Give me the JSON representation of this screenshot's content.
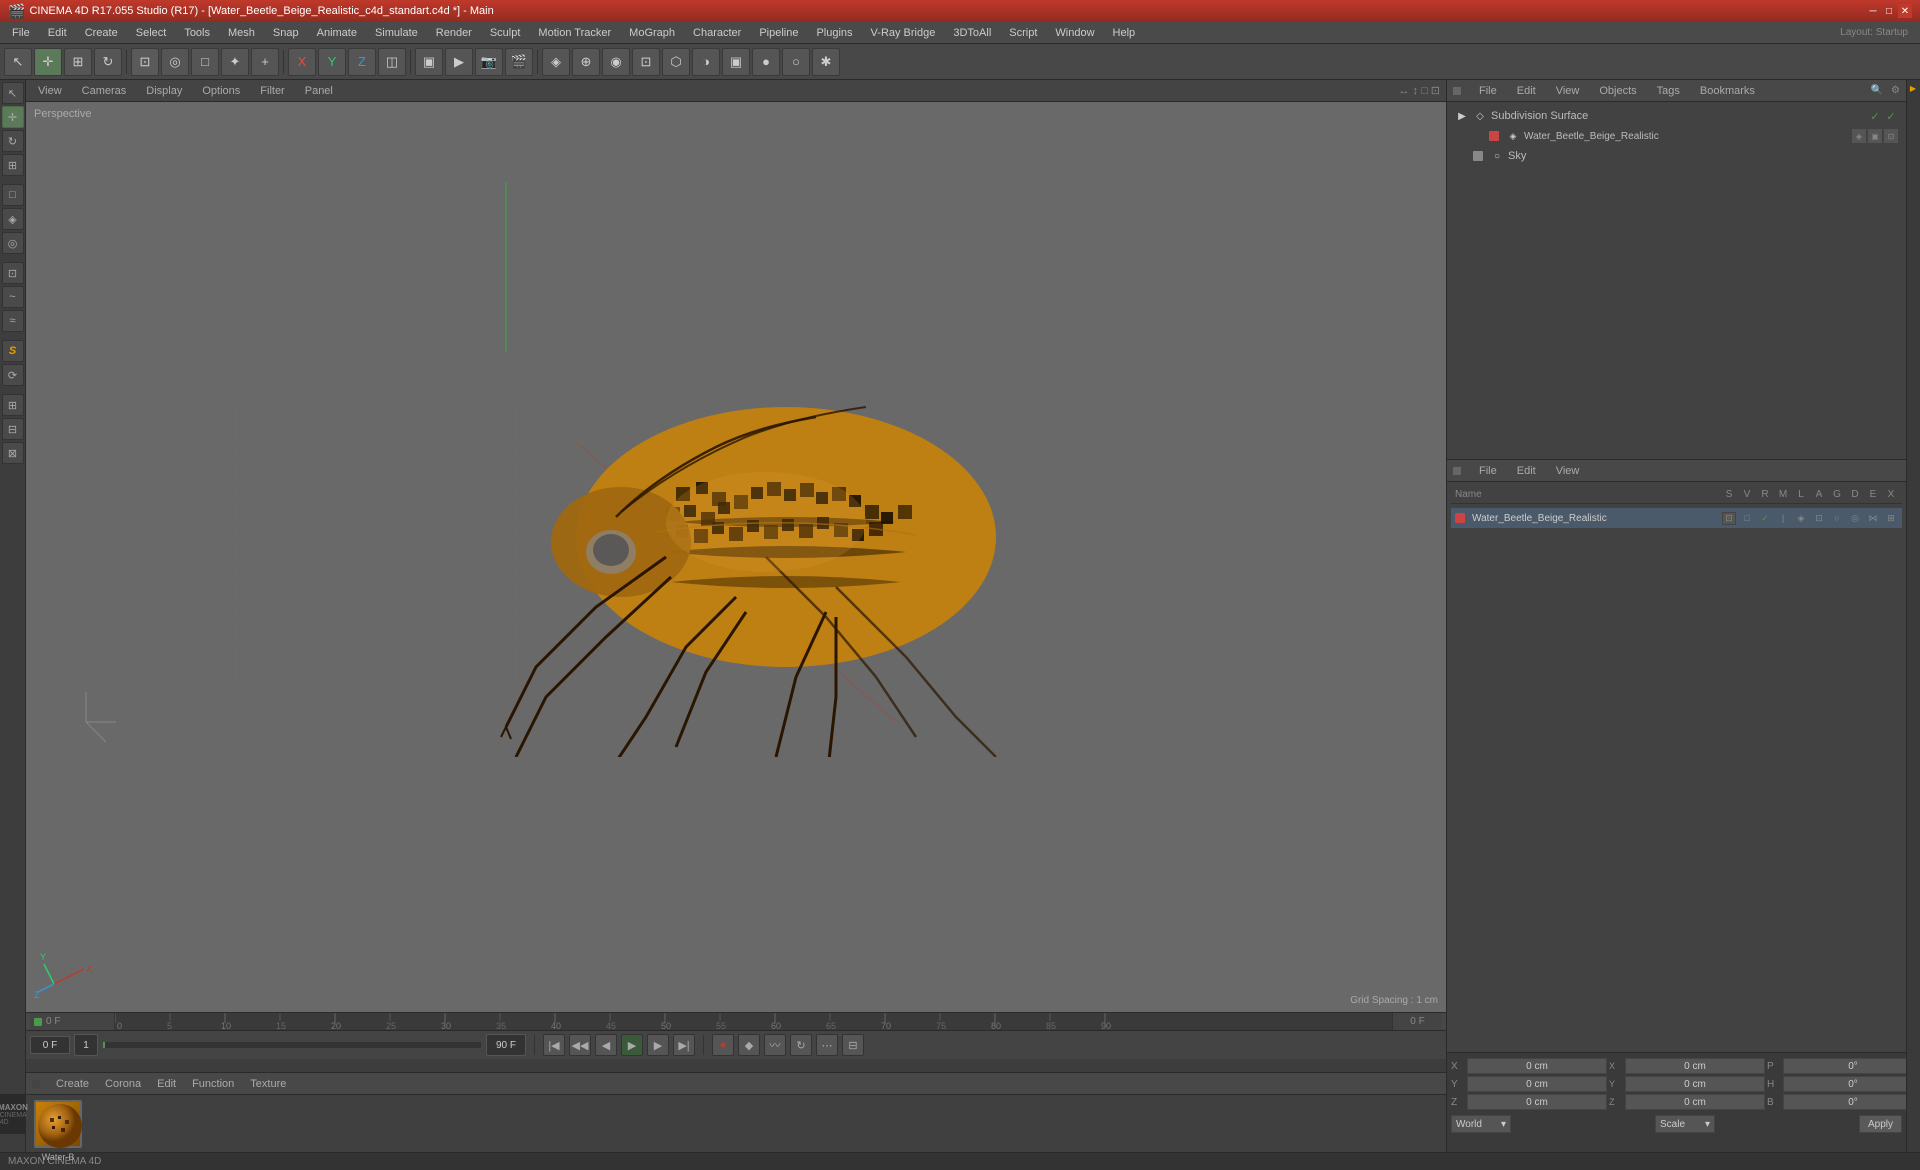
{
  "titlebar": {
    "title": "CINEMA 4D R17.055 Studio (R17) - [Water_Beetle_Beige_Realistic_c4d_standart.c4d *] - Main",
    "layout_label": "Layout:",
    "layout_value": "Startup"
  },
  "menubar": {
    "items": [
      "File",
      "Edit",
      "Create",
      "Select",
      "Tools",
      "Mesh",
      "Snap",
      "Animate",
      "Simulate",
      "Render",
      "Sculpt",
      "Motion Tracker",
      "MoGraph",
      "Character",
      "Pipeline",
      "Plugins",
      "V-Ray Bridge",
      "3DToAll",
      "Script",
      "Window",
      "Help"
    ]
  },
  "viewport": {
    "tabs": [
      "View",
      "Cameras",
      "Display",
      "Options",
      "Filter",
      "Panel"
    ],
    "perspective_label": "Perspective",
    "grid_spacing": "Grid Spacing : 1 cm"
  },
  "object_manager": {
    "menu_items": [
      "File",
      "Edit",
      "View",
      "Objects",
      "Tags",
      "Bookmarks"
    ],
    "objects": [
      {
        "name": "Subdivision Surface",
        "indent": 0,
        "color": "#cccccc",
        "has_checkmark": true,
        "icon": "◇"
      },
      {
        "name": "Water_Beetle_Beige_Realistic",
        "indent": 1,
        "color": "#cc4444",
        "has_checkmark": false,
        "icon": "◈"
      },
      {
        "name": "Sky",
        "indent": 0,
        "color": "#888888",
        "has_checkmark": false,
        "icon": "○"
      }
    ]
  },
  "attribute_manager": {
    "menu_items": [
      "File",
      "Edit",
      "View"
    ],
    "columns": [
      "Name",
      "S",
      "V",
      "R",
      "M",
      "L",
      "A",
      "G",
      "D",
      "E",
      "X"
    ],
    "objects": [
      {
        "name": "Water_Beetle_Beige_Realistic",
        "color": "#cc4444",
        "selected": true
      }
    ]
  },
  "timeline": {
    "ticks": [
      "0",
      "5",
      "10",
      "15",
      "20",
      "25",
      "30",
      "35",
      "40",
      "45",
      "50",
      "55",
      "60",
      "65",
      "70",
      "75",
      "80",
      "85",
      "90"
    ],
    "current_frame": "0 F",
    "frame_input": "0 F",
    "fps": "90 F",
    "playback_fps": "1",
    "frame_range_start": "0 F",
    "frame_range_end": "90 F"
  },
  "material_editor": {
    "tabs": [
      "Create",
      "Corona",
      "Edit",
      "Function",
      "Texture"
    ],
    "material_name": "Water-B",
    "material_label": "Water-B"
  },
  "coordinates": {
    "x_pos": "0 cm",
    "y_pos": "0 cm",
    "z_pos": "0 cm",
    "x_scale": "0 cm",
    "y_scale": "0 cm",
    "z_scale": "0 cm",
    "p_rot": "0°",
    "h_rot": "0°",
    "b_rot": "0°",
    "world_label": "World",
    "scale_label": "Scale",
    "apply_label": "Apply"
  },
  "toolbar_tools": {
    "transform_tools": [
      "↖",
      "↔",
      "↕",
      "⟲"
    ],
    "object_tools": [
      "□",
      "◎",
      "△",
      "✦",
      "+"
    ],
    "mode_icons": [
      "x",
      "y",
      "z",
      "◫"
    ],
    "render_tools": [
      "▶",
      "⬜",
      "📷",
      "🎬"
    ],
    "display_tools": [
      "◈",
      "◉",
      "⬡",
      "○",
      "◑",
      "▣",
      "⊕",
      "●"
    ]
  },
  "left_tools": {
    "tools": [
      "↖",
      "↔",
      "◎",
      "✓",
      "□",
      "◆",
      "~",
      "≈",
      "⌀",
      "S",
      "⟳",
      "⊞",
      "⊟",
      "⊠"
    ]
  }
}
